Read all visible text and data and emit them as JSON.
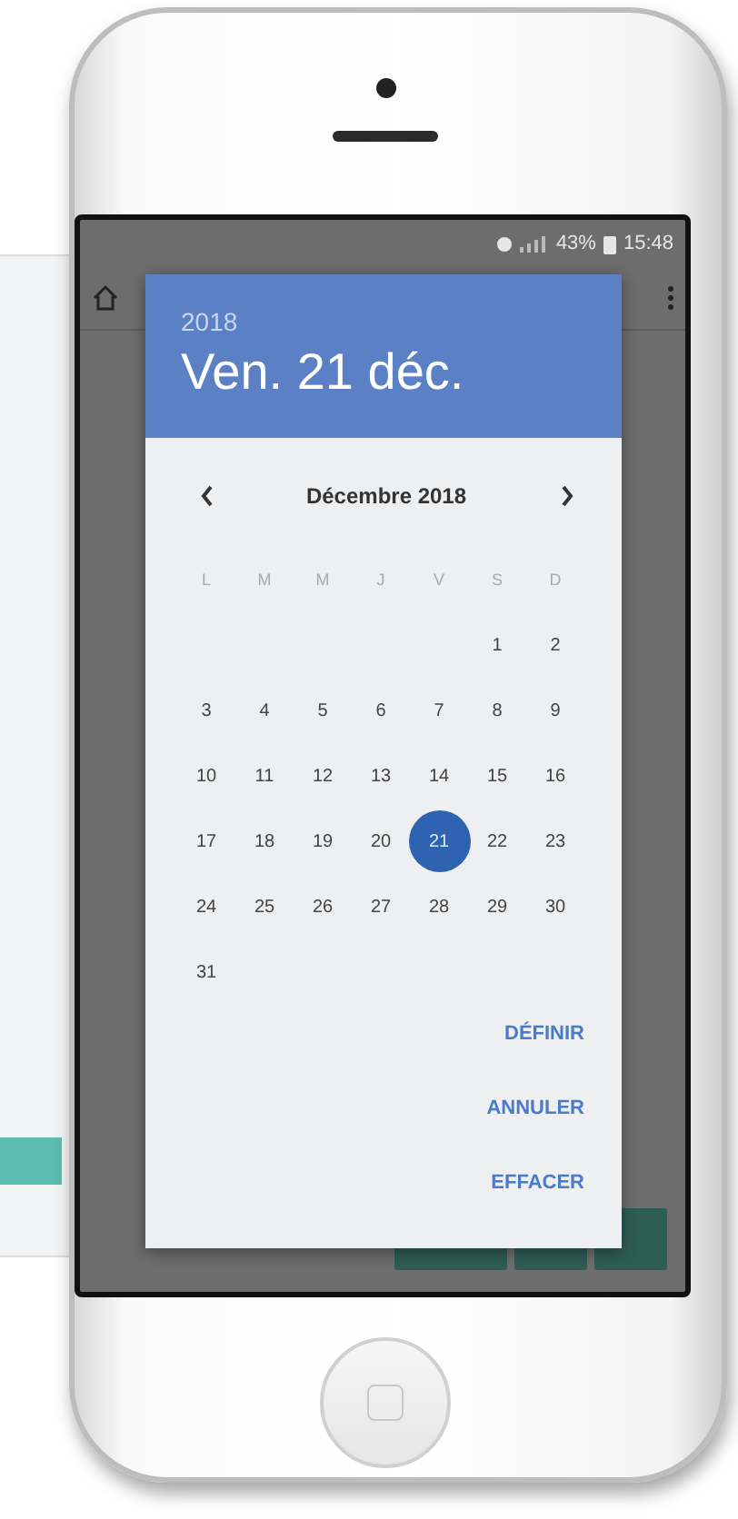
{
  "status_bar": {
    "battery": "43%",
    "time": "15:48"
  },
  "dialog": {
    "year": "2018",
    "date": "Ven. 21 déc.",
    "month": "Décembre 2018",
    "weekdays": [
      "L",
      "M",
      "M",
      "J",
      "V",
      "S",
      "D"
    ],
    "weeks": [
      [
        {
          "day": "1",
          "selected": false
        },
        {
          "day": "2",
          "selected": false
        }
      ],
      [
        {
          "day": "3",
          "selected": false
        },
        {
          "day": "4",
          "selected": false
        },
        {
          "day": "5",
          "selected": false
        },
        {
          "day": "6",
          "selected": false
        },
        {
          "day": "7",
          "selected": false
        },
        {
          "day": "8",
          "selected": false
        },
        {
          "day": "9",
          "selected": false
        }
      ],
      [
        {
          "day": "10",
          "selected": false
        },
        {
          "day": "11",
          "selected": false
        },
        {
          "day": "12",
          "selected": false
        },
        {
          "day": "13",
          "selected": false
        },
        {
          "day": "14",
          "selected": false
        },
        {
          "day": "15",
          "selected": false
        },
        {
          "day": "16",
          "selected": false
        }
      ],
      [
        {
          "day": "17",
          "selected": false
        },
        {
          "day": "18",
          "selected": false
        },
        {
          "day": "19",
          "selected": false
        },
        {
          "day": "20",
          "selected": false
        },
        {
          "day": "21",
          "selected": true
        },
        {
          "day": "22",
          "selected": false
        },
        {
          "day": "23",
          "selected": false
        }
      ],
      [
        {
          "day": "24",
          "selected": false
        },
        {
          "day": "25",
          "selected": false
        },
        {
          "day": "26",
          "selected": false
        },
        {
          "day": "27",
          "selected": false
        },
        {
          "day": "28",
          "selected": false
        },
        {
          "day": "29",
          "selected": false
        },
        {
          "day": "30",
          "selected": false
        }
      ],
      [
        {
          "day": "31",
          "selected": false
        }
      ]
    ],
    "buttons": [
      "DÉFINIR",
      "ANNULER",
      "EFFACER"
    ]
  }
}
